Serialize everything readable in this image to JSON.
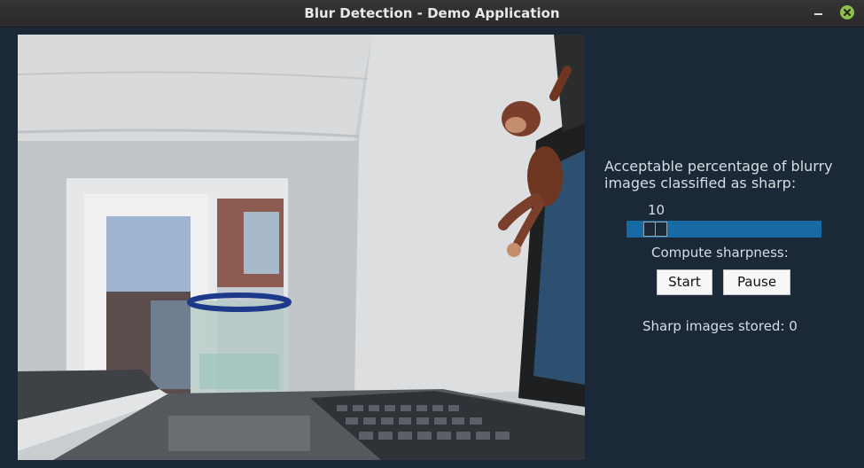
{
  "window": {
    "title": "Blur Detection - Demo Application"
  },
  "controls": {
    "threshold_label": "Acceptable percentage of blurry images classified as sharp:",
    "threshold_value": "10",
    "threshold_fraction": 0.1,
    "compute_label": "Compute sharpness:",
    "start_label": "Start",
    "pause_label": "Pause",
    "stored_label": "Sharp images stored: 0"
  },
  "colors": {
    "background": "#1a2838",
    "slider_track": "#176aa3",
    "close_button": "#8fbd4f"
  }
}
